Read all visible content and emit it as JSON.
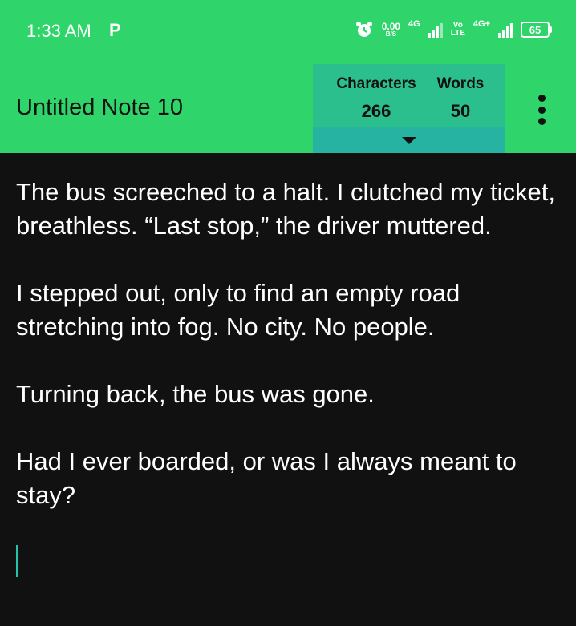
{
  "status_bar": {
    "time": "1:33 AM",
    "notification": "P",
    "speed_value": "0.00",
    "speed_unit": "B/S",
    "network1": "4G",
    "volte_top": "Vo",
    "volte_bottom": "LTE",
    "network2": "4G+",
    "battery": "65",
    "icons": [
      "alarm-icon",
      "signal-icon",
      "signal-icon",
      "battery-icon"
    ]
  },
  "header": {
    "title": "Untitled Note 10",
    "characters_label": "Characters",
    "characters_value": "266",
    "words_label": "Words",
    "words_value": "50",
    "colors": {
      "bar": "#2fd56b",
      "panel": "#2bbf8e",
      "panel_lower": "#27b3a1"
    }
  },
  "note": {
    "paragraphs": [
      "The bus screeched to a halt. I clutched my ticket, breathless. “Last stop,” the driver muttered.",
      "I stepped out, only to find an empty road stretching into fog. No city. No people.",
      "Turning back, the bus was gone.",
      "Had I ever boarded, or was I always meant to stay?"
    ]
  }
}
